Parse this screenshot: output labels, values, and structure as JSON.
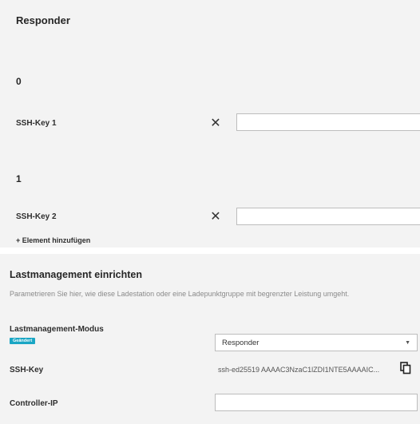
{
  "responder_panel": {
    "title": "Responder",
    "items": [
      {
        "index": "0",
        "label": "SSH-Key 1",
        "value": "",
        "clear_icon": "close-icon"
      },
      {
        "index": "1",
        "label": "SSH-Key 2",
        "value": "",
        "clear_icon": "close-icon"
      }
    ],
    "add_label": "+ Element hinzufügen"
  },
  "loadmanagement": {
    "title": "Lastmanagement einrichten",
    "description": "Parametrieren Sie hier, wie diese Ladestation oder eine Ladepunktgruppe mit begrenzter Leistung umgeht.",
    "mode_label": "Lastmanagement-Modus",
    "mode_badge": "Geändert",
    "mode_value": "Responder",
    "ssh_key_label": "SSH-Key",
    "ssh_key_value": "ssh-ed25519 AAAAC3NzaC1lZDI1NTE5AAAAIC...",
    "copy_icon": "copy-icon",
    "controller_ip_label": "Controller-IP",
    "controller_ip_value": ""
  },
  "colors": {
    "panel_background": "#f3f3f3",
    "badge": "#1aa6c4",
    "description_text": "#8a8a8a"
  }
}
